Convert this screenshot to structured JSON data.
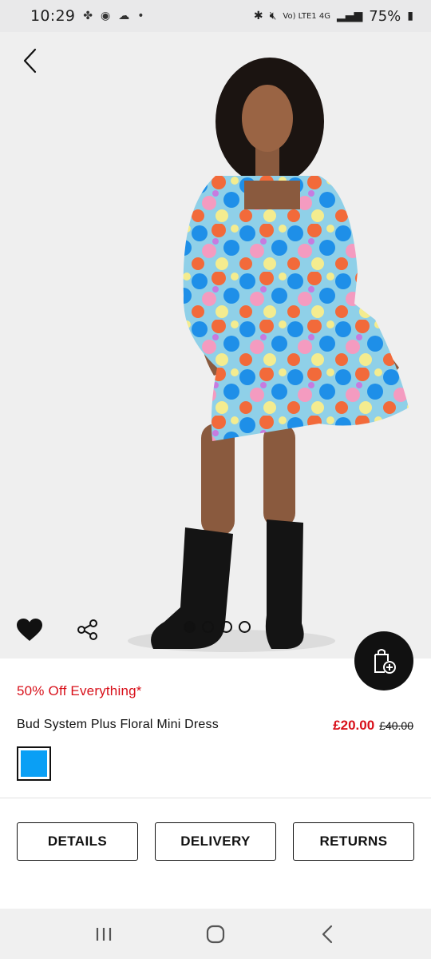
{
  "status_bar": {
    "time": "10:29",
    "left_icons": [
      "fan-icon",
      "news-icon",
      "weather-icon",
      "dot-icon"
    ],
    "right_text": "Vo) LTE1 4G",
    "battery": "75%"
  },
  "product": {
    "promo": "50% Off Everything*",
    "name": "Bud System Plus Floral Mini Dress",
    "price_now": "£20.00",
    "price_was": "£40.00",
    "swatch_color": "#0a9ff5"
  },
  "gallery": {
    "image_count": 4,
    "active_index": 0
  },
  "tabs": [
    {
      "label": "DETAILS"
    },
    {
      "label": "DELIVERY"
    },
    {
      "label": "RETURNS"
    }
  ],
  "icons": {
    "back": "chevron-left-icon",
    "favorite": "heart-icon",
    "share": "share-icon",
    "bag": "add-to-bag-icon",
    "nav_recent": "recent-apps-icon",
    "nav_home": "home-icon",
    "nav_back": "back-icon"
  },
  "colors": {
    "accent_red": "#d8101a",
    "dress_blue": "#1e8fe8",
    "dress_orange": "#f26a3a",
    "dress_pink": "#f49bc0",
    "dress_yellow": "#f4ec8f"
  }
}
